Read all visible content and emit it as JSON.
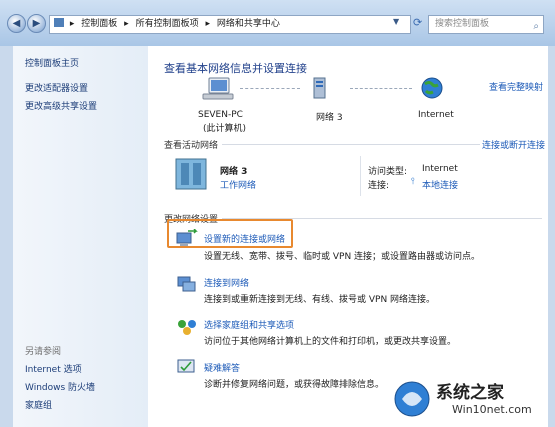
{
  "nav": {
    "back_label": "◀",
    "forward_label": "▶"
  },
  "address": {
    "crumbs": [
      "控制面板",
      "所有控制面板项",
      "网络和共享中心"
    ],
    "sep": "▸"
  },
  "search": {
    "placeholder": "搜索控制面板"
  },
  "sidebar": {
    "top_items": [
      {
        "label": "控制面板主页"
      },
      {
        "label": "更改适配器设置"
      },
      {
        "label": "更改高级共享设置"
      }
    ],
    "see_also_header": "另请参阅",
    "bottom_items": [
      {
        "label": "Internet 选项"
      },
      {
        "label": "Windows 防火墙"
      },
      {
        "label": "家庭组"
      }
    ]
  },
  "main": {
    "title": "查看基本网络信息并设置连接",
    "full_map_link": "查看完整映射",
    "map": {
      "pc_name": "SEVEN-PC",
      "pc_sub": "(此计算机)",
      "network_name": "网络  3",
      "internet_label": "Internet"
    },
    "active_header": "查看活动网络",
    "connect_link": "连接或断开连接",
    "active": {
      "name": "网络  3",
      "type_link": "工作网络",
      "access_type_label": "访问类型:",
      "access_type_value": "Internet",
      "connections_label": "连接:",
      "connections_value": "本地连接"
    },
    "change_header": "更改网络设置",
    "tasks": [
      {
        "title": "设置新的连接或网络",
        "desc": "设置无线、宽带、拨号、临时或 VPN 连接；或设置路由器或访问点。"
      },
      {
        "title": "连接到网络",
        "desc": "连接到或重新连接到无线、有线、拨号或 VPN 网络连接。"
      },
      {
        "title": "选择家庭组和共享选项",
        "desc": "访问位于其他网络计算机上的文件和打印机，或更改共享设置。"
      },
      {
        "title": "疑难解答",
        "desc": "诊断并修复网络问题，或获得故障排除信息。"
      }
    ]
  },
  "watermark": {
    "text1": "系统之家",
    "text2": "Win10net.com"
  },
  "colors": {
    "link": "#1e5bb8",
    "highlight": "#e8892f",
    "titlebar": "#a9c6e6"
  }
}
